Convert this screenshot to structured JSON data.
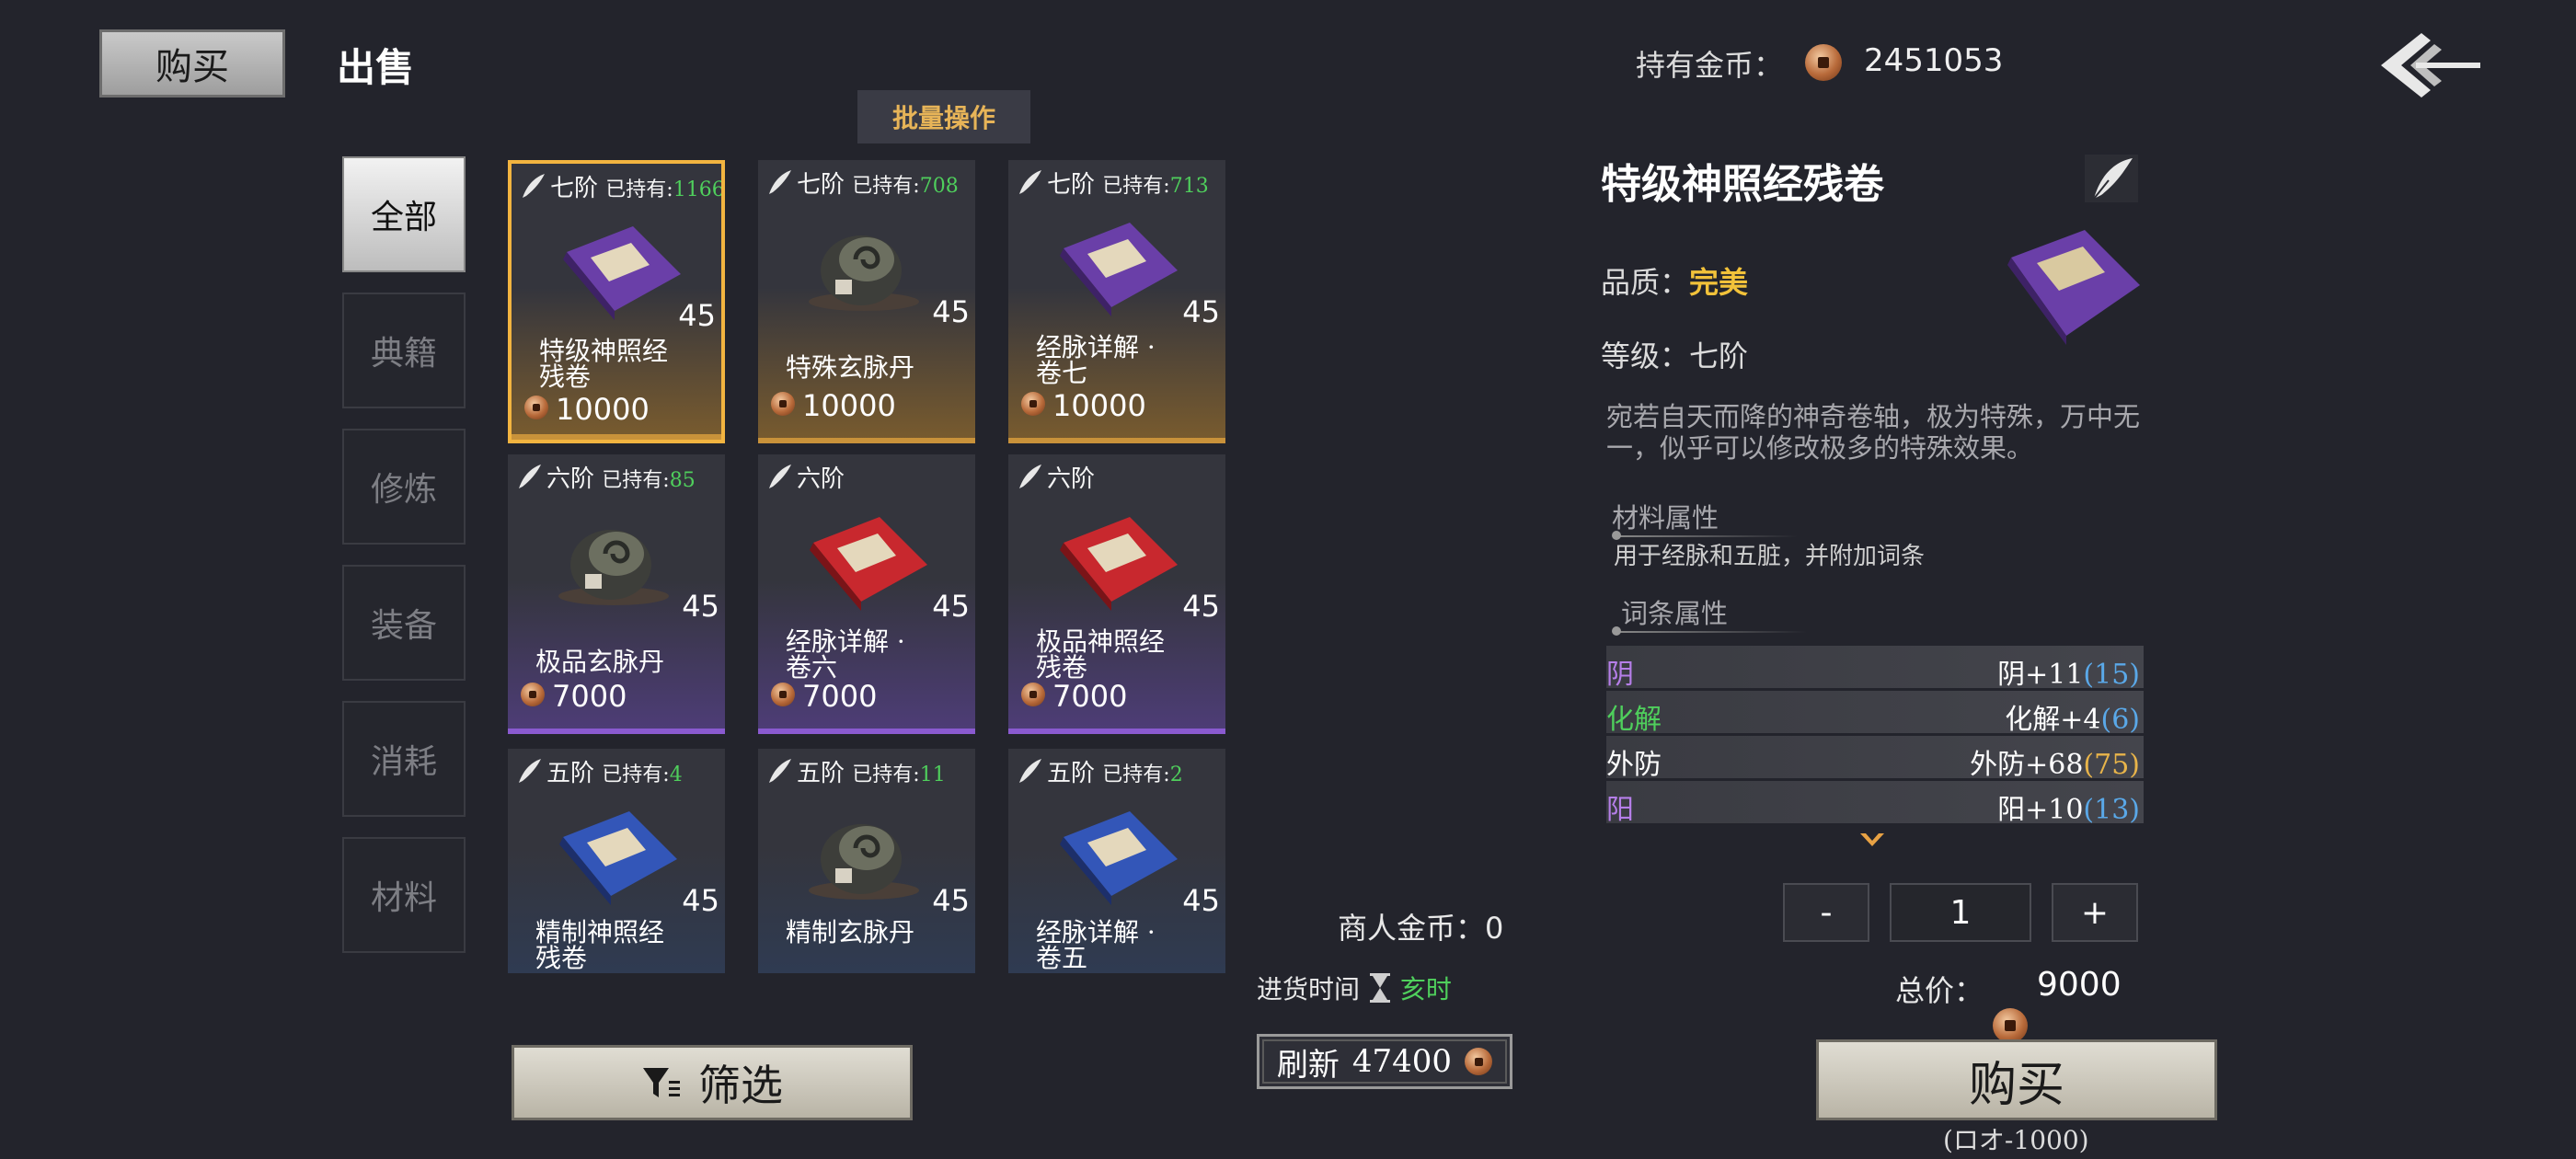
{
  "tabs": {
    "buy": "购买",
    "sell": "出售"
  },
  "gold": {
    "label": "持有金币：",
    "value": "2451053"
  },
  "batch_label": "批量操作",
  "categories": [
    "全部",
    "典籍",
    "修炼",
    "装备",
    "消耗",
    "材料"
  ],
  "active_category": "全部",
  "items": [
    {
      "rank": "七阶",
      "own_label": "已持有:",
      "owned": "1166",
      "level": "45",
      "name1": "特级神照经",
      "name2": "残卷",
      "price": "10000",
      "kind": "book-purple"
    },
    {
      "rank": "七阶",
      "own_label": "已持有:",
      "owned": "708",
      "level": "45",
      "name1": "特殊玄脉丹",
      "name2": "",
      "price": "10000",
      "kind": "pot"
    },
    {
      "rank": "七阶",
      "own_label": "已持有:",
      "owned": "713",
      "level": "45",
      "name1": "经脉详解 ·",
      "name2": "卷七",
      "price": "10000",
      "kind": "book-purple"
    },
    {
      "rank": "六阶",
      "own_label": "已持有:",
      "owned": "85",
      "level": "45",
      "name1": "极品玄脉丹",
      "name2": "",
      "price": "7000",
      "kind": "pot"
    },
    {
      "rank": "六阶",
      "own_label": "",
      "owned": "",
      "level": "45",
      "name1": "经脉详解 ·",
      "name2": "卷六",
      "price": "7000",
      "kind": "book-red"
    },
    {
      "rank": "六阶",
      "own_label": "",
      "owned": "",
      "level": "45",
      "name1": "极品神照经",
      "name2": "残卷",
      "price": "7000",
      "kind": "book-red"
    },
    {
      "rank": "五阶",
      "own_label": "已持有:",
      "owned": "4",
      "level": "45",
      "name1": "精制神照经",
      "name2": "残卷",
      "price": "",
      "kind": "book-blue"
    },
    {
      "rank": "五阶",
      "own_label": "已持有:",
      "owned": "11",
      "level": "45",
      "name1": "精制玄脉丹",
      "name2": "",
      "price": "",
      "kind": "pot"
    },
    {
      "rank": "五阶",
      "own_label": "已持有:",
      "owned": "2",
      "level": "45",
      "name1": "经脉详解 ·",
      "name2": "卷五",
      "price": "",
      "kind": "book-blue"
    }
  ],
  "filter_label": "筛选",
  "merchant": {
    "label": "商人金币：",
    "value": "0"
  },
  "restock": {
    "label": "进货时间",
    "time": "亥时"
  },
  "refresh": {
    "label": "刷新",
    "cost": "47400"
  },
  "detail": {
    "title": "特级神照经残卷",
    "quality_label": "品质：",
    "quality_value": "完美",
    "level_label": "等级：",
    "level_value": "七阶",
    "description": "宛若自天而降的神奇卷轴，极为特殊，万中无一，似乎可以修改极多的特殊效果。",
    "material_title": "材料属性",
    "material_text": "用于经脉和五脏，并附加词条",
    "affix_title": "词条属性",
    "affixes": [
      {
        "name": "阴",
        "value": "阴+11",
        "max": "(15)",
        "name_color": "#b57ee8",
        "max_color": "#5aa8e8"
      },
      {
        "name": "化解",
        "value": "化解+4",
        "max": "(6)",
        "name_color": "#4fcf5c",
        "max_color": "#5aa8e8"
      },
      {
        "name": "外防",
        "value": "外防+68",
        "max": "(75)",
        "name_color": "#ffffff",
        "max_color": "#e8b44a"
      },
      {
        "name": "阳",
        "value": "阳+10",
        "max": "(13)",
        "name_color": "#b57ee8",
        "max_color": "#5aa8e8"
      }
    ]
  },
  "quantity": {
    "minus": "-",
    "value": "1",
    "plus": "+"
  },
  "total": {
    "label": "总价：",
    "value": "9000"
  },
  "buy_button": "购买",
  "buy_limit": "(ロオ-1000)"
}
